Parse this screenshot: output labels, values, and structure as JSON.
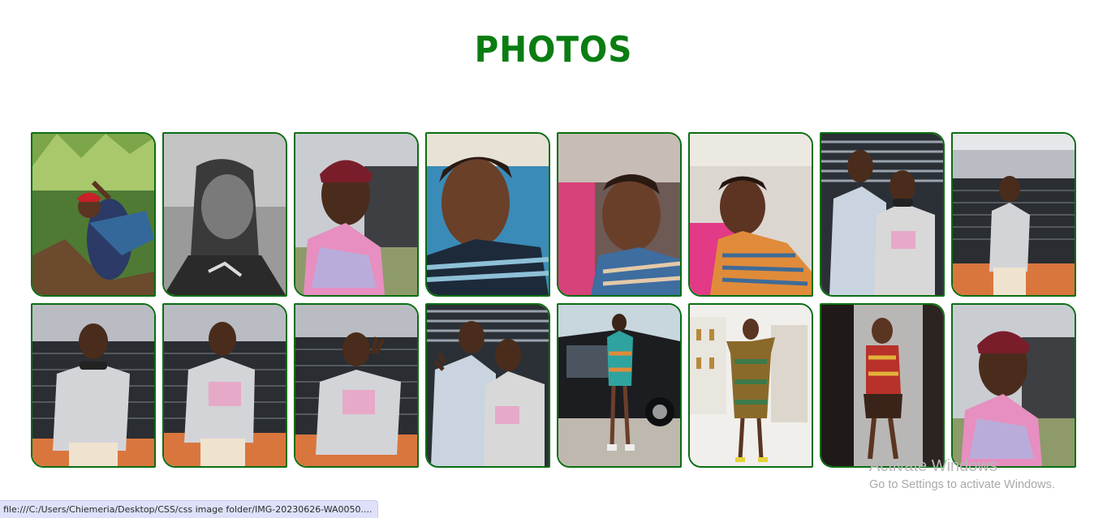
{
  "page": {
    "title": "PHOTOS"
  },
  "colors": {
    "title": "#0a7d12",
    "border": "#0b6e12",
    "status_bg": "#dee1f9"
  },
  "photos": [
    {
      "scene": "forest",
      "person": "top-red-headwrap-waving"
    },
    {
      "scene": "grayscale",
      "person": "braids-closeup"
    },
    {
      "scene": "outdoor-gate",
      "person": "burgundy-headwrap-pink-hoodie"
    },
    {
      "scene": "blue-wall",
      "person": "selfie-striped-top"
    },
    {
      "scene": "car-interior",
      "person": "braids-selfie-striped"
    },
    {
      "scene": "office",
      "person": "braids-striped-top"
    },
    {
      "scene": "striped-gate",
      "person": "couple-hoodies"
    },
    {
      "scene": "gate-house",
      "person": "grey-hoodie-standing"
    },
    {
      "scene": "gate-house",
      "person": "grey-hoodie-hands-pocket"
    },
    {
      "scene": "gate-house",
      "person": "grey-hoodie-smiling"
    },
    {
      "scene": "gate-house",
      "person": "grey-hoodie-peace-sign"
    },
    {
      "scene": "striped-gate",
      "person": "couple-peace-sign"
    },
    {
      "scene": "parking",
      "person": "ankara-dress-by-car"
    },
    {
      "scene": "trophy-room",
      "person": "ankara-dress-studio"
    },
    {
      "scene": "dark-studio",
      "person": "fringe-dress"
    },
    {
      "scene": "outdoor-gate",
      "person": "burgundy-headwrap-pink-hoodie"
    }
  ],
  "status_bar": {
    "url": "file:///C:/Users/Chiemeria/Desktop/CSS/css image folder/IMG-20230626-WA0050...."
  },
  "watermark": {
    "title": "Activate Windows",
    "subtitle": "Go to Settings to activate Windows."
  }
}
